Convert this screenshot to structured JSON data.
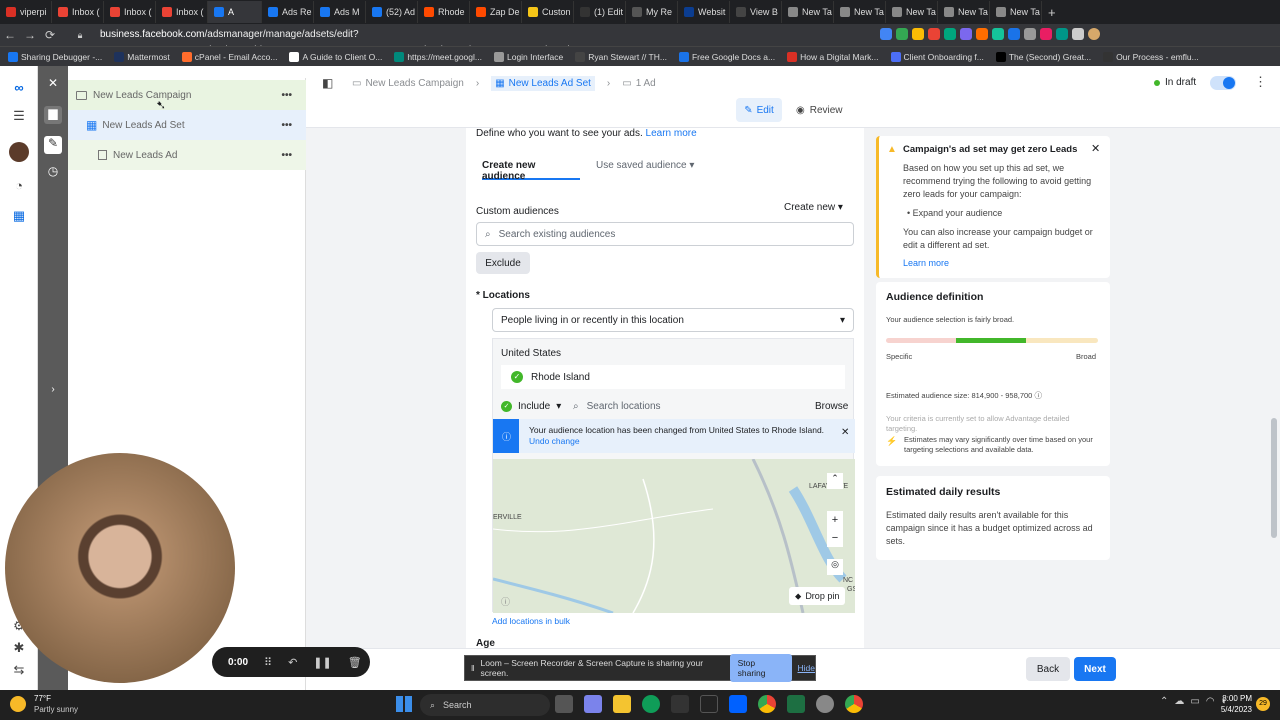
{
  "browser": {
    "tabs": [
      {
        "label": "viperpi",
        "color": "#d93025"
      },
      {
        "label": "Inbox (",
        "color": "#ea4335"
      },
      {
        "label": "Inbox (",
        "color": "#ea4335"
      },
      {
        "label": "Inbox (",
        "color": "#ea4335"
      },
      {
        "label": "A",
        "color": "#1877f2"
      },
      {
        "label": "Ads Re",
        "color": "#1877f2"
      },
      {
        "label": "Ads M",
        "color": "#1877f2"
      },
      {
        "label": "(52) Ad",
        "color": "#1877f2"
      },
      {
        "label": "Rhode",
        "color": "#ff4a00"
      },
      {
        "label": "Zap De",
        "color": "#ff4a00"
      },
      {
        "label": "Custon",
        "color": "#f5c518"
      },
      {
        "label": "(1) Edit",
        "color": "#333333"
      },
      {
        "label": "My Re",
        "color": "#555555"
      },
      {
        "label": "Websit",
        "color": "#0b3d91"
      },
      {
        "label": "View B",
        "color": "#444444"
      },
      {
        "label": "New Ta",
        "color": "#888888"
      },
      {
        "label": "New Ta",
        "color": "#888888"
      },
      {
        "label": "New Ta",
        "color": "#888888"
      },
      {
        "label": "New Ta",
        "color": "#888888"
      },
      {
        "label": "New Ta",
        "color": "#888888"
      }
    ],
    "url_host": "business.facebook.com",
    "url_path": "/adsmanager/manage/adsets/edit?act=706041350678941&business_id=1502754159816730&nav_entry_point=bm_ad_account_open_in_ads_manager_...",
    "bookmarks": [
      "Sharing Debugger -...",
      "Mattermost",
      "cPanel - Email Acco...",
      "A Guide to Client O...",
      "https://meet.googl...",
      "Login Interface",
      "Ryan Stewart // TH...",
      "Free Google Docs a...",
      "How a Digital Mark...",
      "Client Onboarding f...",
      "The (Second) Great...",
      "Our Process - emflu..."
    ]
  },
  "sidebar": {
    "campaign": "New Leads Campaign",
    "adset": "New Leads Ad Set",
    "ad": "New Leads Ad",
    "more": "•••"
  },
  "toolbar": {
    "crumbs": [
      "New Leads Campaign",
      "New Leads Ad Set",
      "1 Ad"
    ],
    "status": "In draft",
    "edit": "Edit",
    "review": "Review"
  },
  "form": {
    "intro": "Define who you want to see your ads.",
    "intro_link": "Learn more",
    "tab_create": "Create new audience",
    "tab_saved": "Use saved audience",
    "custom_label": "Custom audiences",
    "create_new": "Create new",
    "search_placeholder": "Search existing audiences",
    "exclude": "Exclude",
    "locations_label": "* Locations",
    "location_type": "People living in or recently in this location",
    "country": "United States",
    "region": "Rhode Island",
    "include": "Include",
    "search_locations": "Search locations",
    "browse": "Browse",
    "notice": "Your audience location has been changed from United States to Rhode Island.",
    "undo": "Undo change",
    "map_label_1": "LAFAYETTE",
    "map_label_2": "ERVILLE",
    "map_label_3": "NC",
    "map_label_4": "GS",
    "drop_pin": "Drop pin",
    "bulk": "Add locations in bulk",
    "age": "Age"
  },
  "warning": {
    "title": "Campaign's ad set may get zero Leads",
    "body": "Based on how you set up this ad set, we recommend trying the following to avoid getting zero leads for your campaign:",
    "bullet": "Expand your audience",
    "body2": "You can also increase your campaign budget or edit a different ad set.",
    "link": "Learn more"
  },
  "audience": {
    "title": "Audience definition",
    "desc": "Your audience selection is fairly broad.",
    "specific": "Specific",
    "broad": "Broad",
    "size": "Estimated audience size: 814,900 - 958,700",
    "criteria": "Your criteria is currently set to allow Advantage detailed targeting.",
    "estimates": "Estimates may vary significantly over time based on your targeting selections and available data."
  },
  "daily": {
    "title": "Estimated daily results",
    "body": "Estimated daily results aren't available for this campaign since it has a budget optimized across ad sets."
  },
  "bottom": {
    "back": "Back",
    "next": "Next"
  },
  "loom": {
    "time": "0:00",
    "share_text": "Loom – Screen Recorder & Screen Capture is sharing your screen.",
    "stop": "Stop sharing",
    "hide": "Hide"
  },
  "taskbar": {
    "temp": "77°F",
    "weather": "Partly sunny",
    "search": "Search",
    "time": "8:00 PM",
    "date": "5/4/2023",
    "badge": "29"
  }
}
